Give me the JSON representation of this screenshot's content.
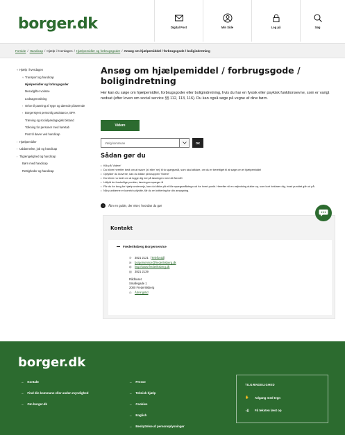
{
  "header": {
    "logo": "borger.dk",
    "nav": [
      {
        "label": "Digital Post",
        "icon": "mail-icon"
      },
      {
        "label": "Min Side",
        "icon": "user-icon"
      },
      {
        "label": "Log på",
        "icon": "lock-icon"
      },
      {
        "label": "Søg",
        "icon": "search-icon"
      }
    ]
  },
  "breadcrumb": {
    "items": [
      "Forside",
      "Handicap",
      "Hjælp i hverdagen",
      "Hjælpemidler og forbrugsgoder"
    ],
    "current": "Ansøg om hjælpemiddel / forbrugsgode / boligindretning"
  },
  "sidebar": {
    "items": [
      {
        "label": "Hjælp i hverdagen",
        "level": 1
      },
      {
        "label": "Transport og handicap",
        "level": 2
      },
      {
        "label": "Hjælpemidler og forbrugsgoder",
        "level": 2,
        "active": true
      },
      {
        "label": "Merudgifter voksne",
        "level": 2
      },
      {
        "label": "Ledsagerordning",
        "level": 2
      },
      {
        "label": "Orlov til pasning af syge og døende pårørende",
        "level": 2
      },
      {
        "label": "Borgerstyret personlig assistance, BPA",
        "level": 2
      },
      {
        "label": "Træning og socialpædagogisk bistand",
        "level": 2
      },
      {
        "label": "Tolkning for personer med høretab",
        "level": 2
      },
      {
        "label": "Post til døvre ved handicap",
        "level": 2
      },
      {
        "label": "Hjælpemidler",
        "level": 1
      },
      {
        "label": "Uddannelse, job og handicap",
        "level": 1
      },
      {
        "label": "Tilgængelighed og handicap",
        "level": 1
      },
      {
        "label": "Børn med handicap",
        "level": 1
      },
      {
        "label": "Rettigheder og handicap",
        "level": 1
      }
    ]
  },
  "main": {
    "title": "Ansøg om hjælpemiddel / forbrugsgode / boligindretning",
    "intro": "Her kan du søge om hjælpemidler, forbrugsgoder eller boligindretning, hvis du har en fysisk eller psykisk funktionsevne, som er varigt nedsat (efter loven om social service §§ 112, 113, 116). Du kan også søge på vegne af dine børn.",
    "videre_button": "Videre",
    "municipality_select": "Vælg kommune",
    "ok_button": "OK",
    "steps_title": "Sådan gør du",
    "steps": [
      "Klik på 'Videre'",
      "Du bliver herefter bedt om at svare 'ja' eller 'nej' til to spørgsmål, som skal afklare, om du er berettiget til at søge om et hjælpemiddel",
      "Opfylder du kravene, kan du klikke på knappen 'Videre'",
      "Du bliver nu bedt om at logge dig ind på løsningen med dit NemID",
      "Udfyld de forskellige punkter, løsningen spørger til",
      "Får du for brug for hjælp undervejs, kan du klikke på et lille spørgsmålstegn ud for hvert punkt. Herefter vil en vejledning dukke op, som kort forklarer dig, hvad punktet går ud på.",
      "Når punkterne er korrekt udfyldte, får du en kvittering for din ansøgning."
    ],
    "guide_link": "Åbn en guide, der viser, hvordan du gør"
  },
  "contact": {
    "title": "Kontakt",
    "org": "Frederiksberg Borgerservice",
    "phone": "3821 2121",
    "phone_link": "Telefontid",
    "email": "borgerservice@frederiksberg.dk",
    "web": "http://www.frederiksberg.dk",
    "fax": "3821 2139",
    "address": [
      "Rådhuset",
      "Smallegade 1",
      "2000 Frederiksberg"
    ],
    "hours_link": "Åbningstid"
  },
  "footer": {
    "logo": "borger.dk",
    "col1": [
      "Kontakt",
      "Find din kommune eller anden myndighed",
      "Om borger.dk"
    ],
    "col2": [
      "Presse",
      "Teknisk hjælp",
      "Cookies",
      "English",
      "Beskyttelse af personoplysninger"
    ],
    "accessibility_title": "TILGÆNGELIGHED",
    "accessibility_items": [
      "Adgang med tegn",
      "Få teksten læst op"
    ]
  },
  "colors": {
    "brand": "#2c6b2f",
    "dark": "#1a1a1a",
    "crumb_bg": "#f1f1f1"
  }
}
